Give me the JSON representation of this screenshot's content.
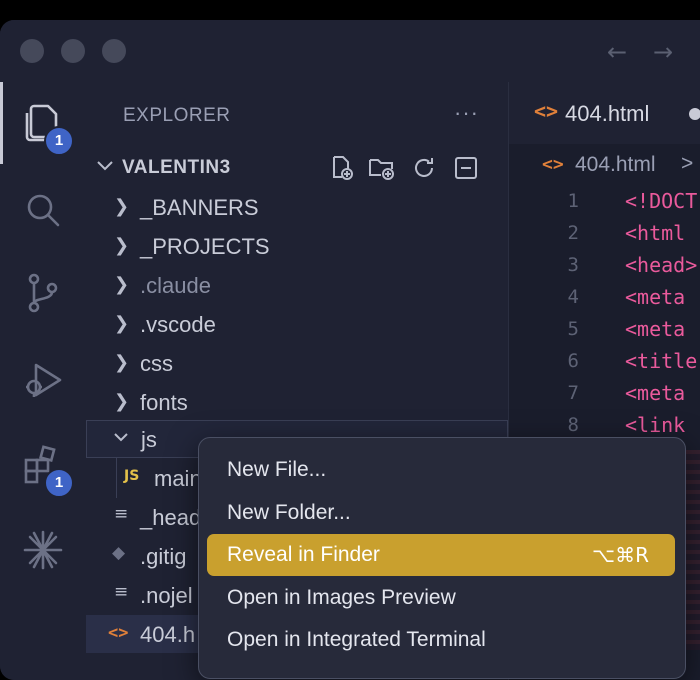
{
  "sidebar": {
    "title": "EXPLORER",
    "more": "···",
    "root": "VALENTIN3",
    "items": [
      {
        "label": "_BANNERS",
        "type": "folder",
        "expanded": false
      },
      {
        "label": "_PROJECTS",
        "type": "folder",
        "expanded": false
      },
      {
        "label": ".claude",
        "type": "folder",
        "expanded": false,
        "dim": true
      },
      {
        "label": ".vscode",
        "type": "folder",
        "expanded": false
      },
      {
        "label": "css",
        "type": "folder",
        "expanded": false
      },
      {
        "label": "fonts",
        "type": "folder",
        "expanded": false
      },
      {
        "label": "js",
        "type": "folder",
        "expanded": true
      },
      {
        "label": "main",
        "type": "file",
        "icon": "JS"
      },
      {
        "label": "_head",
        "type": "file",
        "icon": "lines-icon"
      },
      {
        "label": ".gitig",
        "type": "file",
        "icon": "git-icon"
      },
      {
        "label": ".nojel",
        "type": "file",
        "icon": "lines-icon"
      },
      {
        "label": "404.h",
        "type": "file",
        "icon": "<>"
      }
    ]
  },
  "activity": {
    "explorer_badge": "1",
    "extensions_badge": "1"
  },
  "editor": {
    "tab_icon": "<>",
    "tab_name": "404.html",
    "crumb_icon": "<>",
    "crumb_name": "404.html",
    "crumb_sep": ">",
    "lines": [
      {
        "n": "1",
        "code": "<!DOCT"
      },
      {
        "n": "2",
        "code": "<html"
      },
      {
        "n": "3",
        "code": "<head>"
      },
      {
        "n": "4",
        "code": "<meta"
      },
      {
        "n": "5",
        "code": "<meta"
      },
      {
        "n": "6",
        "code": "<title"
      },
      {
        "n": "7",
        "code": "<meta"
      },
      {
        "n": "8",
        "code": "<link"
      }
    ]
  },
  "menu": {
    "items": [
      {
        "label": "New File...",
        "shortcut": ""
      },
      {
        "label": "New Folder...",
        "shortcut": ""
      },
      {
        "label": "Reveal in Finder",
        "shortcut": "⌥⌘R"
      },
      {
        "label": "Open in Images Preview",
        "shortcut": ""
      },
      {
        "label": "Open in Integrated Terminal",
        "shortcut": ""
      }
    ]
  },
  "titlebar": {
    "back": "←",
    "forward": "→"
  },
  "colors": {
    "accent": "#c9a02e",
    "badge": "#3f64c6",
    "html_icon": "#e0803a",
    "js_icon": "#e3c14a"
  }
}
